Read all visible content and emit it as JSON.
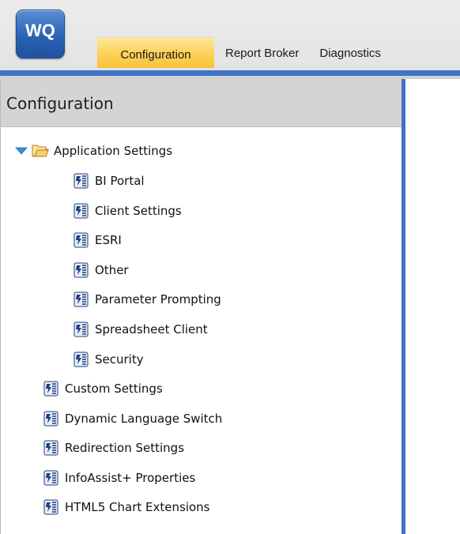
{
  "app": {
    "logo_text": "WQ"
  },
  "tabs": [
    {
      "label": "Configuration",
      "active": true
    },
    {
      "label": "Report Broker",
      "active": false
    },
    {
      "label": "Diagnostics",
      "active": false
    }
  ],
  "panel": {
    "title": "Configuration",
    "tree": {
      "root": {
        "label": "Application Settings",
        "expanded": true
      },
      "children": [
        {
          "label": "BI Portal"
        },
        {
          "label": "Client Settings"
        },
        {
          "label": "ESRI"
        },
        {
          "label": "Other"
        },
        {
          "label": "Parameter Prompting"
        },
        {
          "label": "Spreadsheet Client"
        },
        {
          "label": "Security"
        }
      ],
      "top_level": [
        {
          "label": "Custom Settings"
        },
        {
          "label": "Dynamic Language Switch"
        },
        {
          "label": "Redirection Settings"
        },
        {
          "label": "InfoAssist+ Properties"
        },
        {
          "label": "HTML5 Chart Extensions"
        }
      ]
    }
  },
  "colors": {
    "accent_blue": "#3d74c7",
    "active_tab": "#fcd35a",
    "panel_header": "#d4d4d4"
  },
  "icons": {
    "logo": "wq-logo-icon",
    "expand": "chevron-down-icon",
    "folder": "folder-open-icon",
    "settings_page": "settings-document-icon"
  }
}
